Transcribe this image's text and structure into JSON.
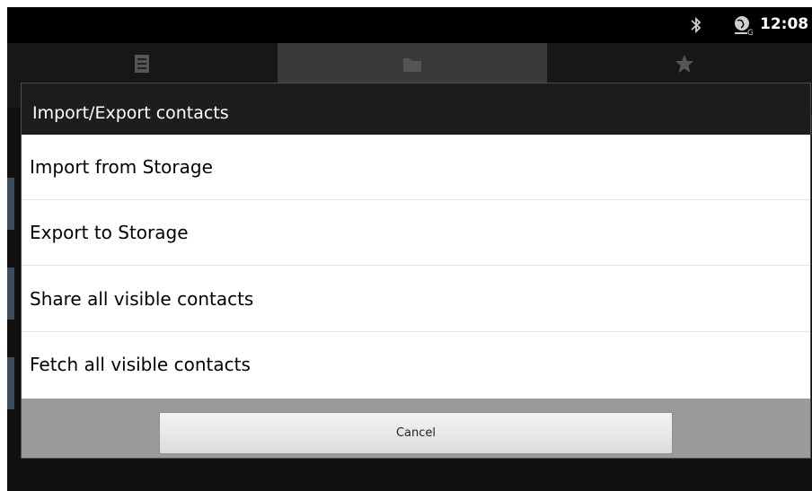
{
  "status_bar": {
    "time": "12:08",
    "icons": [
      "bluetooth-icon",
      "network-globe-icon"
    ]
  },
  "background_app": {
    "tabs": [
      {
        "icon": "list-icon"
      },
      {
        "icon": "folder-icon"
      },
      {
        "icon": "star-icon"
      }
    ]
  },
  "dialog": {
    "title": "Import/Export contacts",
    "items": [
      {
        "label": "Import from Storage"
      },
      {
        "label": "Export to Storage"
      },
      {
        "label": "Share all visible contacts"
      },
      {
        "label": "Fetch all visible contacts"
      }
    ],
    "cancel_label": "Cancel"
  },
  "colors": {
    "dialog_footer": "#9a9a9a",
    "selected_tab": "#3a3a3a"
  }
}
